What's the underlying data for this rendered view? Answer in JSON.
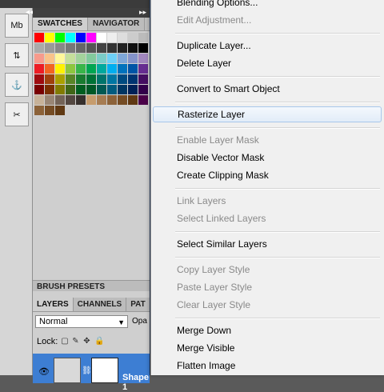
{
  "toolbar": {
    "tools": [
      {
        "name": "mini-bridge-icon",
        "glyph": "Mb"
      },
      {
        "name": "history-icon",
        "glyph": "⇅"
      },
      {
        "name": "plugin-icon",
        "glyph": "⚓"
      },
      {
        "name": "tools-icon",
        "glyph": "✂"
      }
    ]
  },
  "swatches_panel": {
    "tabs": [
      "SWATCHES",
      "NAVIGATOR"
    ],
    "colors": [
      "#ff0000",
      "#ffff00",
      "#00ff00",
      "#00ffff",
      "#0000ff",
      "#ff00ff",
      "#ffffff",
      "#eeeeee",
      "#dddddd",
      "#cccccc",
      "#bbbbbb",
      "#aaaaaa",
      "#999999",
      "#888888",
      "#777777",
      "#666666",
      "#555555",
      "#444444",
      "#333333",
      "#222222",
      "#111111",
      "#000000",
      "#f79a8c",
      "#f9c38a",
      "#fff79a",
      "#c5df9b",
      "#a3d39c",
      "#82ca9d",
      "#7accc8",
      "#6dcff6",
      "#7ea7d8",
      "#8493ca",
      "#a187be",
      "#ed1c24",
      "#f26522",
      "#fff200",
      "#8dc63f",
      "#39b54a",
      "#00a651",
      "#00a99d",
      "#00aeef",
      "#0072bc",
      "#0054a6",
      "#662d91",
      "#9e0b0f",
      "#a0410d",
      "#aba000",
      "#598527",
      "#197b30",
      "#007236",
      "#00746b",
      "#0076a3",
      "#004a80",
      "#003471",
      "#440e62",
      "#790000",
      "#7b2e00",
      "#827b00",
      "#406618",
      "#005e20",
      "#005826",
      "#005952",
      "#005b7f",
      "#003663",
      "#002157",
      "#32004b",
      "#c7b299",
      "#998675",
      "#736357",
      "#534741",
      "#37302d",
      "#c69c6d",
      "#a67c52",
      "#8c6239",
      "#754c24",
      "#603913",
      "#4b0049",
      "#8c6239",
      "#754c24",
      "#603913"
    ]
  },
  "brush_presets": {
    "label": "BRUSH PRESETS"
  },
  "layers_panel": {
    "tabs": [
      "LAYERS",
      "CHANNELS",
      "PAT"
    ],
    "blend_mode": "Normal",
    "opacity_label": "Opa",
    "lock_label": "Lock:",
    "layer_name": "Shape 1"
  },
  "context_menu": {
    "items": [
      {
        "label": "Blending Options...",
        "disabled": false
      },
      {
        "label": "Edit Adjustment...",
        "disabled": true
      },
      {
        "sep": true
      },
      {
        "label": "Duplicate Layer...",
        "disabled": false
      },
      {
        "label": "Delete Layer",
        "disabled": false
      },
      {
        "sep": true
      },
      {
        "label": "Convert to Smart Object",
        "disabled": false
      },
      {
        "sep": true
      },
      {
        "label": "Rasterize Layer",
        "disabled": false,
        "hover": true
      },
      {
        "sep": true
      },
      {
        "label": "Enable Layer Mask",
        "disabled": true
      },
      {
        "label": "Disable Vector Mask",
        "disabled": false
      },
      {
        "label": "Create Clipping Mask",
        "disabled": false
      },
      {
        "sep": true
      },
      {
        "label": "Link Layers",
        "disabled": true
      },
      {
        "label": "Select Linked Layers",
        "disabled": true
      },
      {
        "sep": true
      },
      {
        "label": "Select Similar Layers",
        "disabled": false
      },
      {
        "sep": true
      },
      {
        "label": "Copy Layer Style",
        "disabled": true
      },
      {
        "label": "Paste Layer Style",
        "disabled": true
      },
      {
        "label": "Clear Layer Style",
        "disabled": true
      },
      {
        "sep": true
      },
      {
        "label": "Merge Down",
        "disabled": false
      },
      {
        "label": "Merge Visible",
        "disabled": false
      },
      {
        "label": "Flatten Image",
        "disabled": false
      }
    ]
  }
}
